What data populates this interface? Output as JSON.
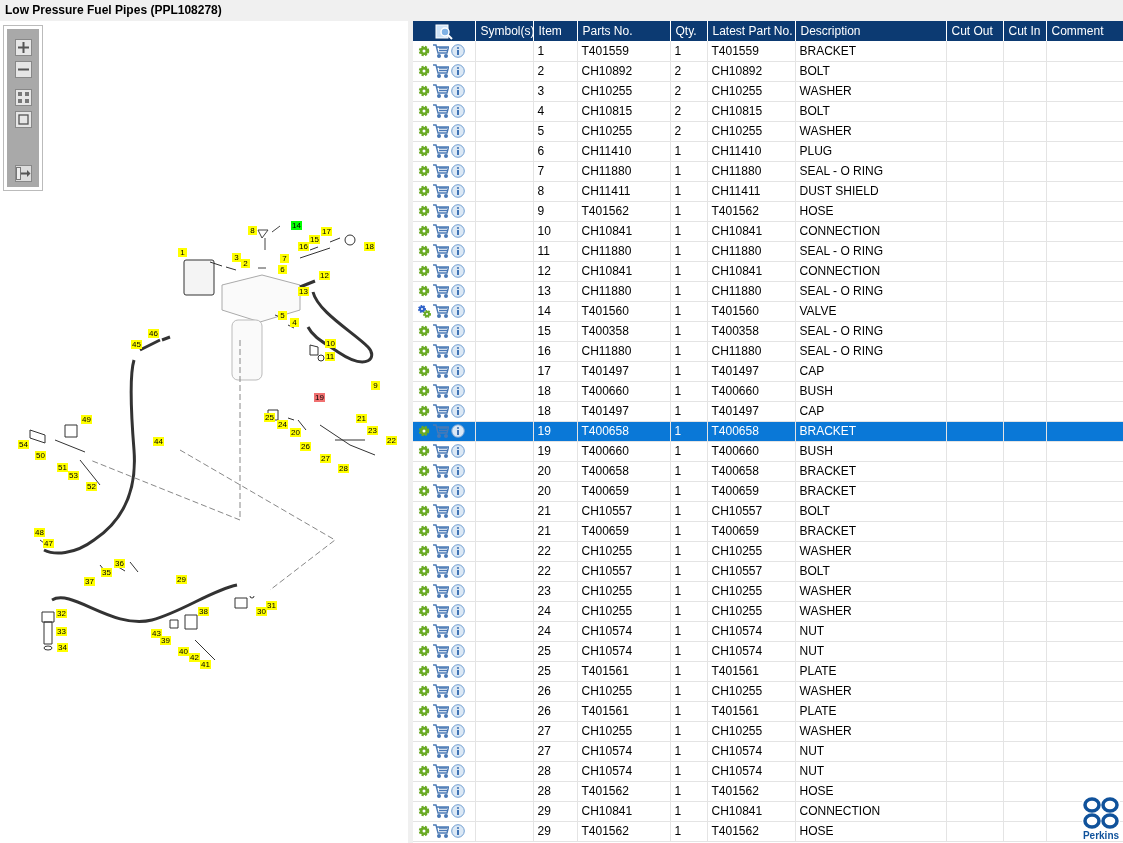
{
  "window": {
    "title": "Low Pressure Fuel Pipes (PPL108278)"
  },
  "callouts": [
    {
      "label": "1",
      "color": "#ffff00"
    },
    {
      "label": "2",
      "color": "#ffff00"
    },
    {
      "label": "3",
      "color": "#ffff00"
    },
    {
      "label": "8",
      "color": "#ffff00"
    },
    {
      "label": "7",
      "color": "#ffff00"
    },
    {
      "label": "6",
      "color": "#ffff00"
    },
    {
      "label": "14",
      "color": "#00ff00"
    },
    {
      "label": "17",
      "color": "#ffff00"
    },
    {
      "label": "15",
      "color": "#ffff00"
    },
    {
      "label": "16",
      "color": "#ffff00"
    },
    {
      "label": "18",
      "color": "#ffff00"
    },
    {
      "label": "12",
      "color": "#ffff00"
    },
    {
      "label": "13",
      "color": "#ffff00"
    },
    {
      "label": "5",
      "color": "#ffff00"
    },
    {
      "label": "4",
      "color": "#ffff00"
    },
    {
      "label": "46",
      "color": "#ffff00"
    },
    {
      "label": "45",
      "color": "#ffff00"
    },
    {
      "label": "10",
      "color": "#ffff00"
    },
    {
      "label": "11",
      "color": "#ffff00"
    },
    {
      "label": "9",
      "color": "#ffff00"
    },
    {
      "label": "19",
      "color": "#f07070"
    },
    {
      "label": "25",
      "color": "#ffff00"
    },
    {
      "label": "24",
      "color": "#ffff00"
    },
    {
      "label": "20",
      "color": "#ffff00"
    },
    {
      "label": "21",
      "color": "#ffff00"
    },
    {
      "label": "23",
      "color": "#ffff00"
    },
    {
      "label": "22",
      "color": "#ffff00"
    },
    {
      "label": "26",
      "color": "#ffff00"
    },
    {
      "label": "27",
      "color": "#ffff00"
    },
    {
      "label": "28",
      "color": "#ffff00"
    },
    {
      "label": "49",
      "color": "#ffff00"
    },
    {
      "label": "54",
      "color": "#ffff00"
    },
    {
      "label": "50",
      "color": "#ffff00"
    },
    {
      "label": "44",
      "color": "#ffff00"
    },
    {
      "label": "51",
      "color": "#ffff00"
    },
    {
      "label": "53",
      "color": "#ffff00"
    },
    {
      "label": "52",
      "color": "#ffff00"
    },
    {
      "label": "48",
      "color": "#ffff00"
    },
    {
      "label": "47",
      "color": "#ffff00"
    },
    {
      "label": "36",
      "color": "#ffff00"
    },
    {
      "label": "35",
      "color": "#ffff00"
    },
    {
      "label": "37",
      "color": "#ffff00"
    },
    {
      "label": "29",
      "color": "#ffff00"
    },
    {
      "label": "31",
      "color": "#ffff00"
    },
    {
      "label": "38",
      "color": "#ffff00"
    },
    {
      "label": "30",
      "color": "#ffff00"
    },
    {
      "label": "32",
      "color": "#ffff00"
    },
    {
      "label": "43",
      "color": "#ffff00"
    },
    {
      "label": "39",
      "color": "#ffff00"
    },
    {
      "label": "33",
      "color": "#ffff00"
    },
    {
      "label": "40",
      "color": "#ffff00"
    },
    {
      "label": "42",
      "color": "#ffff00"
    },
    {
      "label": "41",
      "color": "#ffff00"
    },
    {
      "label": "34",
      "color": "#ffff00"
    }
  ],
  "table": {
    "columns": [
      "Symbol(s)",
      "Item",
      "Parts No.",
      "Qty.",
      "Latest Part No.",
      "Description",
      "Cut Out",
      "Cut In",
      "Comment"
    ],
    "rows": [
      {
        "kind": "part",
        "item": "1",
        "part_no": "T401559",
        "qty": "1",
        "latest_part_no": "T401559",
        "description": "BRACKET",
        "selected": false
      },
      {
        "kind": "part",
        "item": "2",
        "part_no": "CH10892",
        "qty": "2",
        "latest_part_no": "CH10892",
        "description": "BOLT",
        "selected": false
      },
      {
        "kind": "part",
        "item": "3",
        "part_no": "CH10255",
        "qty": "2",
        "latest_part_no": "CH10255",
        "description": "WASHER",
        "selected": false
      },
      {
        "kind": "part",
        "item": "4",
        "part_no": "CH10815",
        "qty": "2",
        "latest_part_no": "CH10815",
        "description": "BOLT",
        "selected": false
      },
      {
        "kind": "part",
        "item": "5",
        "part_no": "CH10255",
        "qty": "2",
        "latest_part_no": "CH10255",
        "description": "WASHER",
        "selected": false
      },
      {
        "kind": "part",
        "item": "6",
        "part_no": "CH11410",
        "qty": "1",
        "latest_part_no": "CH11410",
        "description": "PLUG",
        "selected": false
      },
      {
        "kind": "part",
        "item": "7",
        "part_no": "CH11880",
        "qty": "1",
        "latest_part_no": "CH11880",
        "description": "SEAL - O RING",
        "selected": false
      },
      {
        "kind": "part",
        "item": "8",
        "part_no": "CH11411",
        "qty": "1",
        "latest_part_no": "CH11411",
        "description": "DUST SHIELD",
        "selected": false
      },
      {
        "kind": "part",
        "item": "9",
        "part_no": "T401562",
        "qty": "1",
        "latest_part_no": "T401562",
        "description": "HOSE",
        "selected": false
      },
      {
        "kind": "part",
        "item": "10",
        "part_no": "CH10841",
        "qty": "1",
        "latest_part_no": "CH10841",
        "description": "CONNECTION",
        "selected": false
      },
      {
        "kind": "part",
        "item": "11",
        "part_no": "CH11880",
        "qty": "1",
        "latest_part_no": "CH11880",
        "description": "SEAL - O RING",
        "selected": false
      },
      {
        "kind": "part",
        "item": "12",
        "part_no": "CH10841",
        "qty": "1",
        "latest_part_no": "CH10841",
        "description": "CONNECTION",
        "selected": false
      },
      {
        "kind": "part",
        "item": "13",
        "part_no": "CH11880",
        "qty": "1",
        "latest_part_no": "CH11880",
        "description": "SEAL - O RING",
        "selected": false
      },
      {
        "kind": "assembly",
        "item": "14",
        "part_no": "T401560",
        "qty": "1",
        "latest_part_no": "T401560",
        "description": "VALVE",
        "selected": false
      },
      {
        "kind": "part",
        "item": "15",
        "part_no": "T400358",
        "qty": "1",
        "latest_part_no": "T400358",
        "description": "SEAL - O RING",
        "selected": false
      },
      {
        "kind": "part",
        "item": "16",
        "part_no": "CH11880",
        "qty": "1",
        "latest_part_no": "CH11880",
        "description": "SEAL - O RING",
        "selected": false
      },
      {
        "kind": "part",
        "item": "17",
        "part_no": "T401497",
        "qty": "1",
        "latest_part_no": "T401497",
        "description": "CAP",
        "selected": false
      },
      {
        "kind": "part",
        "item": "18",
        "part_no": "T400660",
        "qty": "1",
        "latest_part_no": "T400660",
        "description": "BUSH",
        "selected": false
      },
      {
        "kind": "part",
        "item": "18",
        "part_no": "T401497",
        "qty": "1",
        "latest_part_no": "T401497",
        "description": "CAP",
        "selected": false
      },
      {
        "kind": "part",
        "item": "19",
        "part_no": "T400658",
        "qty": "1",
        "latest_part_no": "T400658",
        "description": "BRACKET",
        "selected": true
      },
      {
        "kind": "part",
        "item": "19",
        "part_no": "T400660",
        "qty": "1",
        "latest_part_no": "T400660",
        "description": "BUSH",
        "selected": false
      },
      {
        "kind": "part",
        "item": "20",
        "part_no": "T400658",
        "qty": "1",
        "latest_part_no": "T400658",
        "description": "BRACKET",
        "selected": false
      },
      {
        "kind": "part",
        "item": "20",
        "part_no": "T400659",
        "qty": "1",
        "latest_part_no": "T400659",
        "description": "BRACKET",
        "selected": false
      },
      {
        "kind": "part",
        "item": "21",
        "part_no": "CH10557",
        "qty": "1",
        "latest_part_no": "CH10557",
        "description": "BOLT",
        "selected": false
      },
      {
        "kind": "part",
        "item": "21",
        "part_no": "T400659",
        "qty": "1",
        "latest_part_no": "T400659",
        "description": "BRACKET",
        "selected": false
      },
      {
        "kind": "part",
        "item": "22",
        "part_no": "CH10255",
        "qty": "1",
        "latest_part_no": "CH10255",
        "description": "WASHER",
        "selected": false
      },
      {
        "kind": "part",
        "item": "22",
        "part_no": "CH10557",
        "qty": "1",
        "latest_part_no": "CH10557",
        "description": "BOLT",
        "selected": false
      },
      {
        "kind": "part",
        "item": "23",
        "part_no": "CH10255",
        "qty": "1",
        "latest_part_no": "CH10255",
        "description": "WASHER",
        "selected": false
      },
      {
        "kind": "part",
        "item": "24",
        "part_no": "CH10255",
        "qty": "1",
        "latest_part_no": "CH10255",
        "description": "WASHER",
        "selected": false
      },
      {
        "kind": "part",
        "item": "24",
        "part_no": "CH10574",
        "qty": "1",
        "latest_part_no": "CH10574",
        "description": "NUT",
        "selected": false
      },
      {
        "kind": "part",
        "item": "25",
        "part_no": "CH10574",
        "qty": "1",
        "latest_part_no": "CH10574",
        "description": "NUT",
        "selected": false
      },
      {
        "kind": "part",
        "item": "25",
        "part_no": "T401561",
        "qty": "1",
        "latest_part_no": "T401561",
        "description": "PLATE",
        "selected": false
      },
      {
        "kind": "part",
        "item": "26",
        "part_no": "CH10255",
        "qty": "1",
        "latest_part_no": "CH10255",
        "description": "WASHER",
        "selected": false
      },
      {
        "kind": "part",
        "item": "26",
        "part_no": "T401561",
        "qty": "1",
        "latest_part_no": "T401561",
        "description": "PLATE",
        "selected": false
      },
      {
        "kind": "part",
        "item": "27",
        "part_no": "CH10255",
        "qty": "1",
        "latest_part_no": "CH10255",
        "description": "WASHER",
        "selected": false
      },
      {
        "kind": "part",
        "item": "27",
        "part_no": "CH10574",
        "qty": "1",
        "latest_part_no": "CH10574",
        "description": "NUT",
        "selected": false
      },
      {
        "kind": "part",
        "item": "28",
        "part_no": "CH10574",
        "qty": "1",
        "latest_part_no": "CH10574",
        "description": "NUT",
        "selected": false
      },
      {
        "kind": "part",
        "item": "28",
        "part_no": "T401562",
        "qty": "1",
        "latest_part_no": "T401562",
        "description": "HOSE",
        "selected": false
      },
      {
        "kind": "part",
        "item": "29",
        "part_no": "CH10841",
        "qty": "1",
        "latest_part_no": "CH10841",
        "description": "CONNECTION",
        "selected": false
      },
      {
        "kind": "part",
        "item": "29",
        "part_no": "T401562",
        "qty": "1",
        "latest_part_no": "T401562",
        "description": "HOSE",
        "selected": false
      }
    ]
  },
  "logo": {
    "text": "Perkins"
  }
}
